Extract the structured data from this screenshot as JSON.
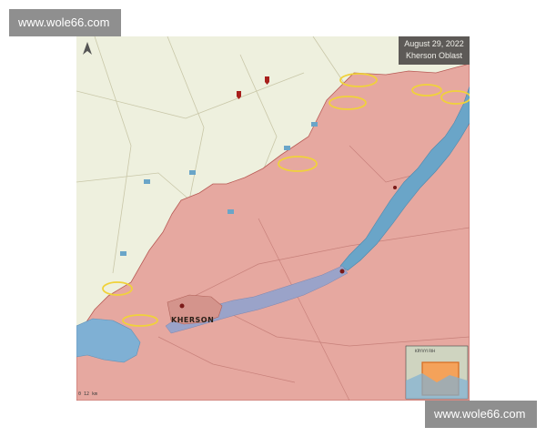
{
  "watermark": {
    "top_text": "www.wole66.com",
    "bottom_text": "www.wole66.com"
  },
  "banner": {
    "date": "August 29, 2022",
    "region": "Kherson Oblast"
  },
  "map": {
    "city_label": "KHERSON",
    "inset_label": "KRYVYI RIH",
    "scale_text": "0 12 km"
  },
  "colors": {
    "occupied": "#e6a8a0",
    "free": "#eef0de",
    "river": "#6aa5c8",
    "highlight": "#f0d23a",
    "banner": "#5d5a57"
  }
}
